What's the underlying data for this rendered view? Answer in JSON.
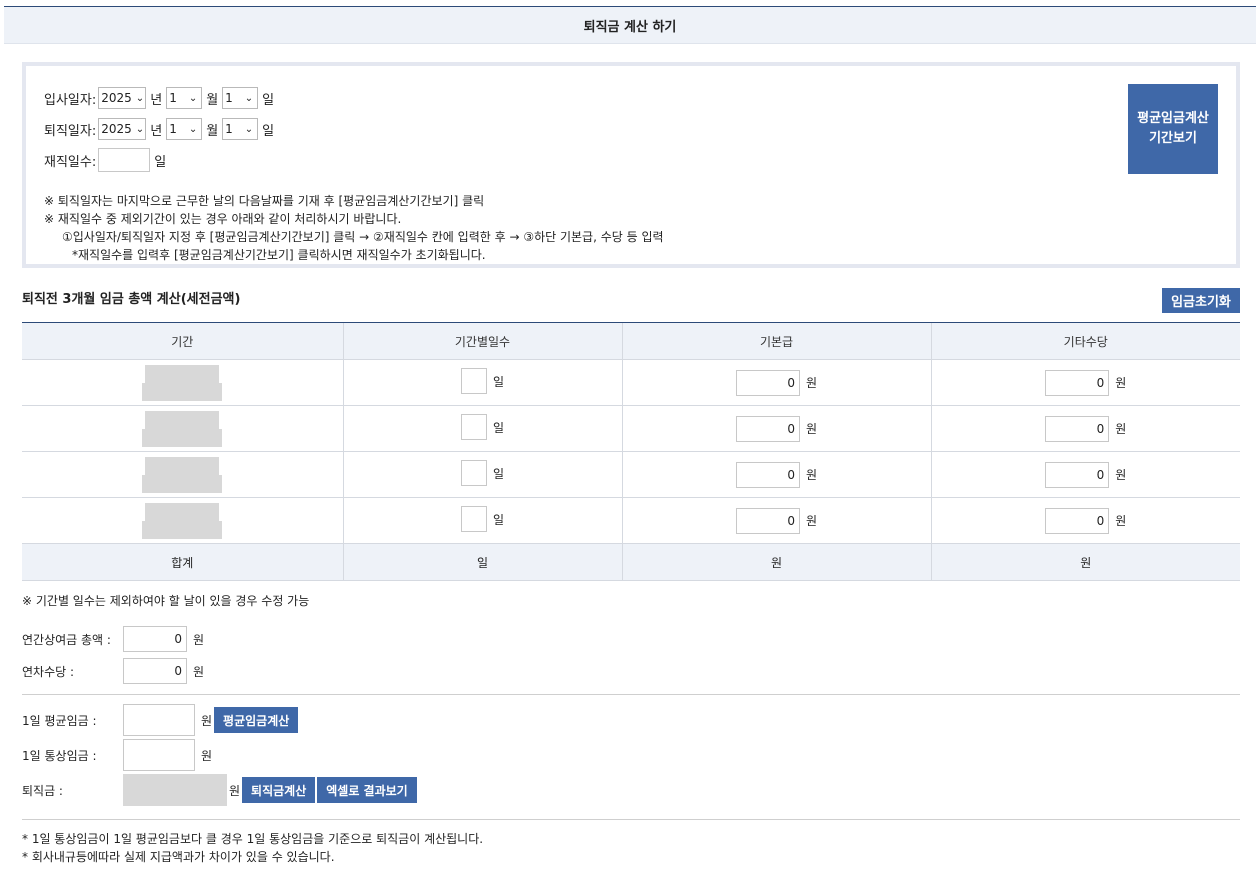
{
  "header": {
    "title": "퇴직금 계산 하기"
  },
  "dates": {
    "join_label": "입사일자:",
    "leave_label": "퇴직일자:",
    "year": "2025",
    "month": "1",
    "day": "1",
    "year_unit": "년",
    "month_unit": "월",
    "day_unit": "일",
    "days_label": "재직일수:",
    "days_unit": "일"
  },
  "notes": [
    "※ 퇴직일자는 마지막으로 근무한 날의 다음날짜를 기재 후 [평균임금계산기간보기] 클릭",
    "※ 재직일수 중 제외기간이 있는 경우 아래와 같이 처리하시기 바랍니다.",
    "①입사일자/퇴직일자 지정 후 [평균임금계산기간보기] 클릭 → ②재직일수 칸에 입력한 후 → ③하단 기본급, 수당 등 입력",
    "*재직일수를 입력후 [평균임금계산기간보기] 클릭하시면 재직일수가 초기화됩니다."
  ],
  "period_button": {
    "line1": "평균임금계산",
    "line2": "기간보기"
  },
  "section": {
    "title": "퇴직전 3개월 임금 총액 계산(세전금액)",
    "reset_button": "임금초기화"
  },
  "table": {
    "headers": [
      "기간",
      "기간별일수",
      "기본급",
      "기타수당"
    ],
    "day_unit": "일",
    "won_unit": "원",
    "rows": [
      {
        "base": "0",
        "other": "0"
      },
      {
        "base": "0",
        "other": "0"
      },
      {
        "base": "0",
        "other": "0"
      },
      {
        "base": "0",
        "other": "0"
      }
    ],
    "total": {
      "label": "합계",
      "days": "일",
      "base": "원",
      "other": "원"
    }
  },
  "period_note": "※ 기간별 일수는 제외하여야 할 날이 있을 경우 수정 가능",
  "bonus": {
    "label": "연간상여금 총액 :",
    "value": "0",
    "unit": "원"
  },
  "annual_leave": {
    "label": "연차수당 :",
    "value": "0",
    "unit": "원"
  },
  "avg_wage": {
    "label": "1일 평균임금 :",
    "unit": "원",
    "button": "평균임금계산"
  },
  "ordinary_wage": {
    "label": "1일 통상임금 :",
    "unit": "원"
  },
  "severance": {
    "label": "퇴직금 :",
    "unit": "원",
    "calc_button": "퇴직금계산",
    "excel_button": "엑셀로 결과보기"
  },
  "footnotes": [
    "* 1일 통상임금이 1일 평균임금보다 클 경우 1일 통상임금을 기준으로 퇴직금이 계산됩니다.",
    "* 회사내규등에따라 실제 지급액과가 차이가 있을 수 있습니다."
  ]
}
